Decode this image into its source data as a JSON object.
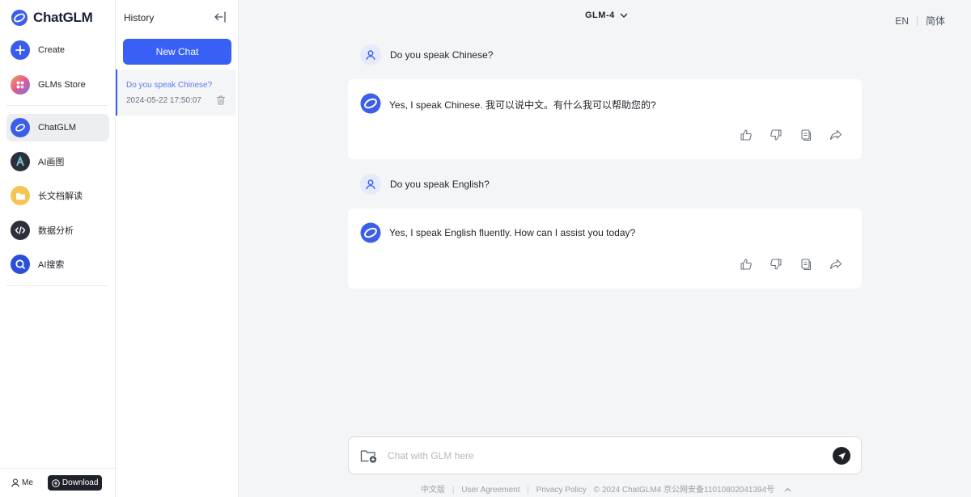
{
  "app": {
    "name": "ChatGLM"
  },
  "sidebar": {
    "items": [
      {
        "label": "Create",
        "icon": "plus-icon"
      },
      {
        "label": "GLMs Store",
        "icon": "store-icon"
      },
      {
        "label": "ChatGLM",
        "icon": "chatglm-icon",
        "active": true
      },
      {
        "label": "AI画图",
        "icon": "ai-draw-icon"
      },
      {
        "label": "长文档解读",
        "icon": "document-icon"
      },
      {
        "label": "数据分析",
        "icon": "code-icon"
      },
      {
        "label": "AI搜索",
        "icon": "search-icon"
      }
    ],
    "me_label": "Me",
    "download_label": "Download"
  },
  "history": {
    "title": "History",
    "new_chat_label": "New Chat",
    "items": [
      {
        "title": "Do you speak Chinese?",
        "date": "2024-05-22 17:50:07"
      }
    ]
  },
  "header": {
    "model": "GLM-4",
    "lang_en": "EN",
    "lang_zh": "简体"
  },
  "conversation": [
    {
      "user": "Do you speak Chinese?",
      "bot": "Yes, I speak Chinese. 我可以说中文。有什么我可以帮助您的?"
    },
    {
      "user": "Do you speak English?",
      "bot": "Yes, I speak English fluently. How can I assist you today?"
    }
  ],
  "input": {
    "placeholder": "Chat with GLM here"
  },
  "footer": {
    "cn_version": "中文版",
    "user_agreement": "User Agreement",
    "privacy_policy": "Privacy Policy",
    "copyright": "© 2024 ChatGLM4 京公网安备11010802041394号"
  },
  "colors": {
    "accent": "#3860f4",
    "bot_avatar": "#3c5ee8",
    "dark": "#1f2329"
  }
}
